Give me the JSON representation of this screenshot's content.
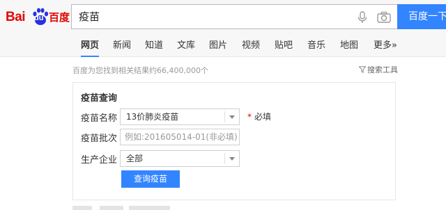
{
  "logo": {
    "text_bai": "Bai",
    "text_du": "du",
    "text_cn": "百度"
  },
  "search": {
    "query": "疫苗",
    "button_label": "百度一下"
  },
  "nav": {
    "items": [
      {
        "label": "网页",
        "active": true
      },
      {
        "label": "新闻"
      },
      {
        "label": "知道"
      },
      {
        "label": "文库"
      },
      {
        "label": "图片"
      },
      {
        "label": "视频"
      },
      {
        "label": "贴吧"
      },
      {
        "label": "音乐"
      },
      {
        "label": "地图"
      },
      {
        "label": "更多»"
      }
    ]
  },
  "results": {
    "count_text": "百度为您找到相关结果约66,400,000个",
    "tools_label": "搜索工具"
  },
  "vaccine_card": {
    "title": "疫苗查询",
    "name_label": "疫苗名称",
    "name_value": "13价肺炎疫苗",
    "required_star": "*",
    "required_text": "必填",
    "batch_label": "疫苗批次",
    "batch_placeholder": "例如:201605014-01(非必填)",
    "company_label": "生产企业",
    "company_value": "全部",
    "query_button": "查询疫苗"
  },
  "colors": {
    "brand_red": "#e10602",
    "brand_blue": "#3385ff"
  },
  "icons": [
    "baidu-paw-icon",
    "microphone-icon",
    "camera-icon",
    "filter-icon",
    "dropdown-arrow-icon"
  ]
}
